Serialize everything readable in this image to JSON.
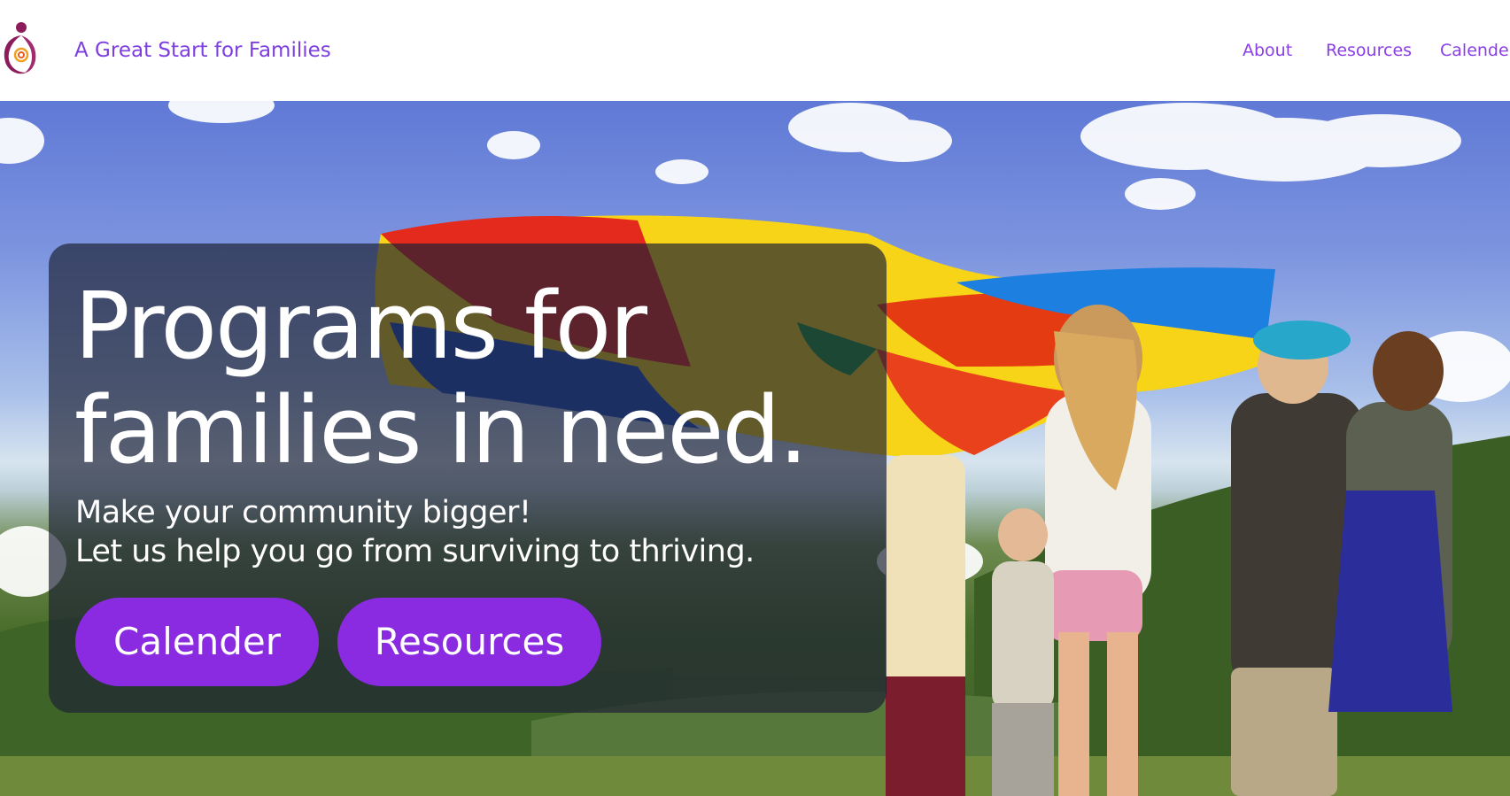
{
  "header": {
    "logo_icon": "family-figure-icon",
    "brand": "A Great Start for Families",
    "nav": [
      {
        "label": "About"
      },
      {
        "label": "Resources"
      },
      {
        "label": "Calender"
      }
    ]
  },
  "hero": {
    "image": "children-holding-parachute-image",
    "headline": "Programs for families in need.",
    "subtext_lines": [
      "Make your community bigger!",
      "Let us help you go from surviving to thriving."
    ],
    "buttons": [
      {
        "label": "Calender"
      },
      {
        "label": "Resources"
      }
    ]
  },
  "colors": {
    "accent": "#8a2be2",
    "link": "#8a3ee8",
    "overlay": "#1c2034"
  }
}
